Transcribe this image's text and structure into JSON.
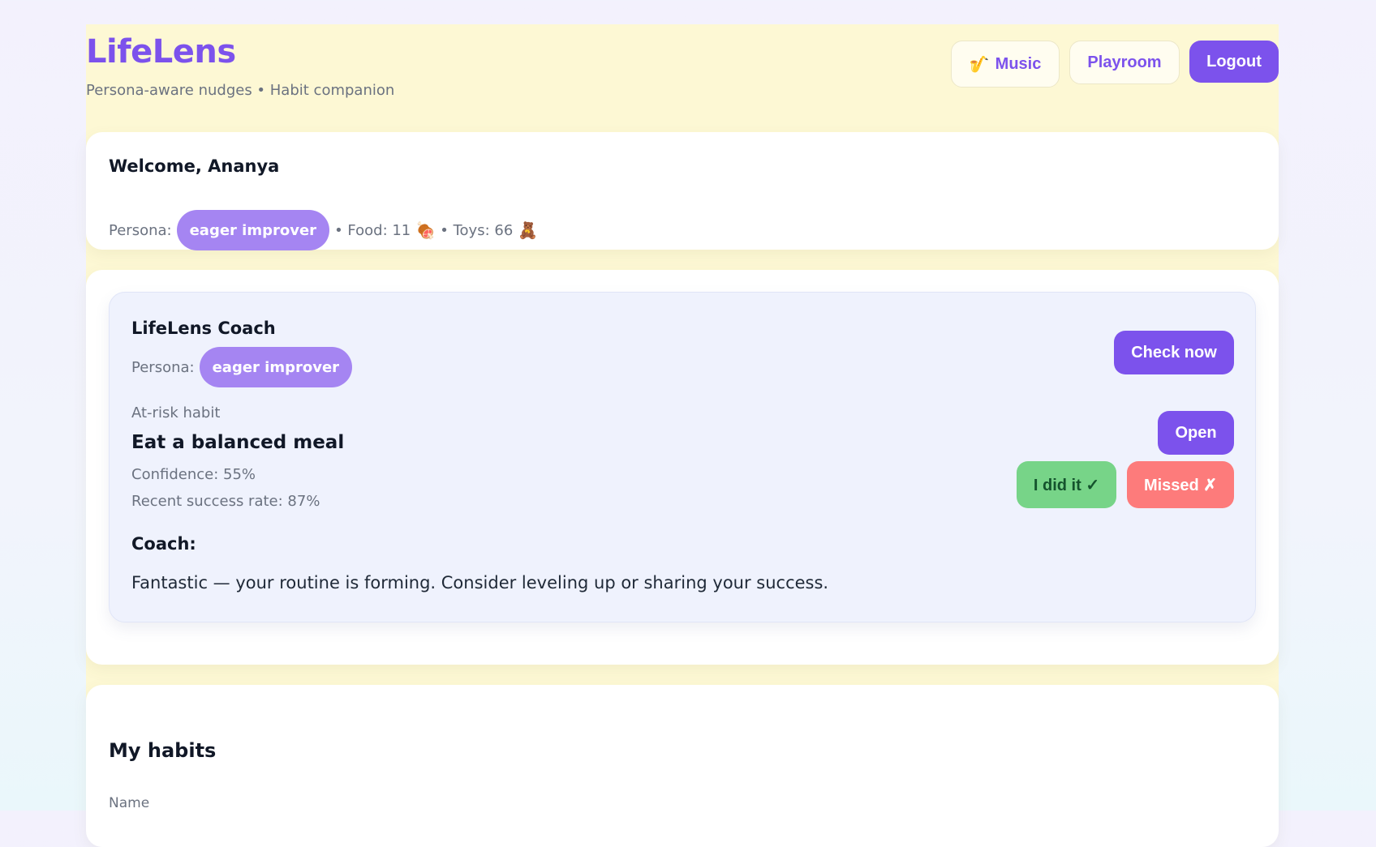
{
  "header": {
    "title": "LifeLens",
    "subtitle": "Persona-aware nudges • Habit companion",
    "buttons": {
      "music_icon": "🎷",
      "music_label": "Music",
      "playroom_label": "Playroom",
      "logout_label": "Logout"
    }
  },
  "welcome": {
    "title": "Welcome, Ananya",
    "persona_label": "Persona:",
    "persona_value": "eager improver",
    "food_text": "• Food: 11",
    "food_icon": "🍖",
    "toys_text": "• Toys: 66",
    "toys_icon": "🧸"
  },
  "coach": {
    "title": "LifeLens Coach",
    "persona_label": "Persona:",
    "persona_value": "eager improver",
    "check_now_label": "Check now",
    "at_risk_label": "At-risk habit",
    "habit_name": "Eat a balanced meal",
    "confidence": "Confidence: 55%",
    "success_rate": "Recent success rate: 87%",
    "open_label": "Open",
    "did_it_label": "I did it ✓",
    "missed_label": "Missed ✗",
    "coach_label": "Coach:",
    "message": "Fantastic — your routine is forming. Consider leveling up or sharing your success."
  },
  "habits": {
    "title": "My habits",
    "columns": [
      "Name"
    ]
  },
  "colors": {
    "accent": "#7c52ec",
    "pill": "#a585f2",
    "success": "#77d488",
    "danger": "#fd7b7b",
    "shell_background": "#fdf8d4"
  }
}
